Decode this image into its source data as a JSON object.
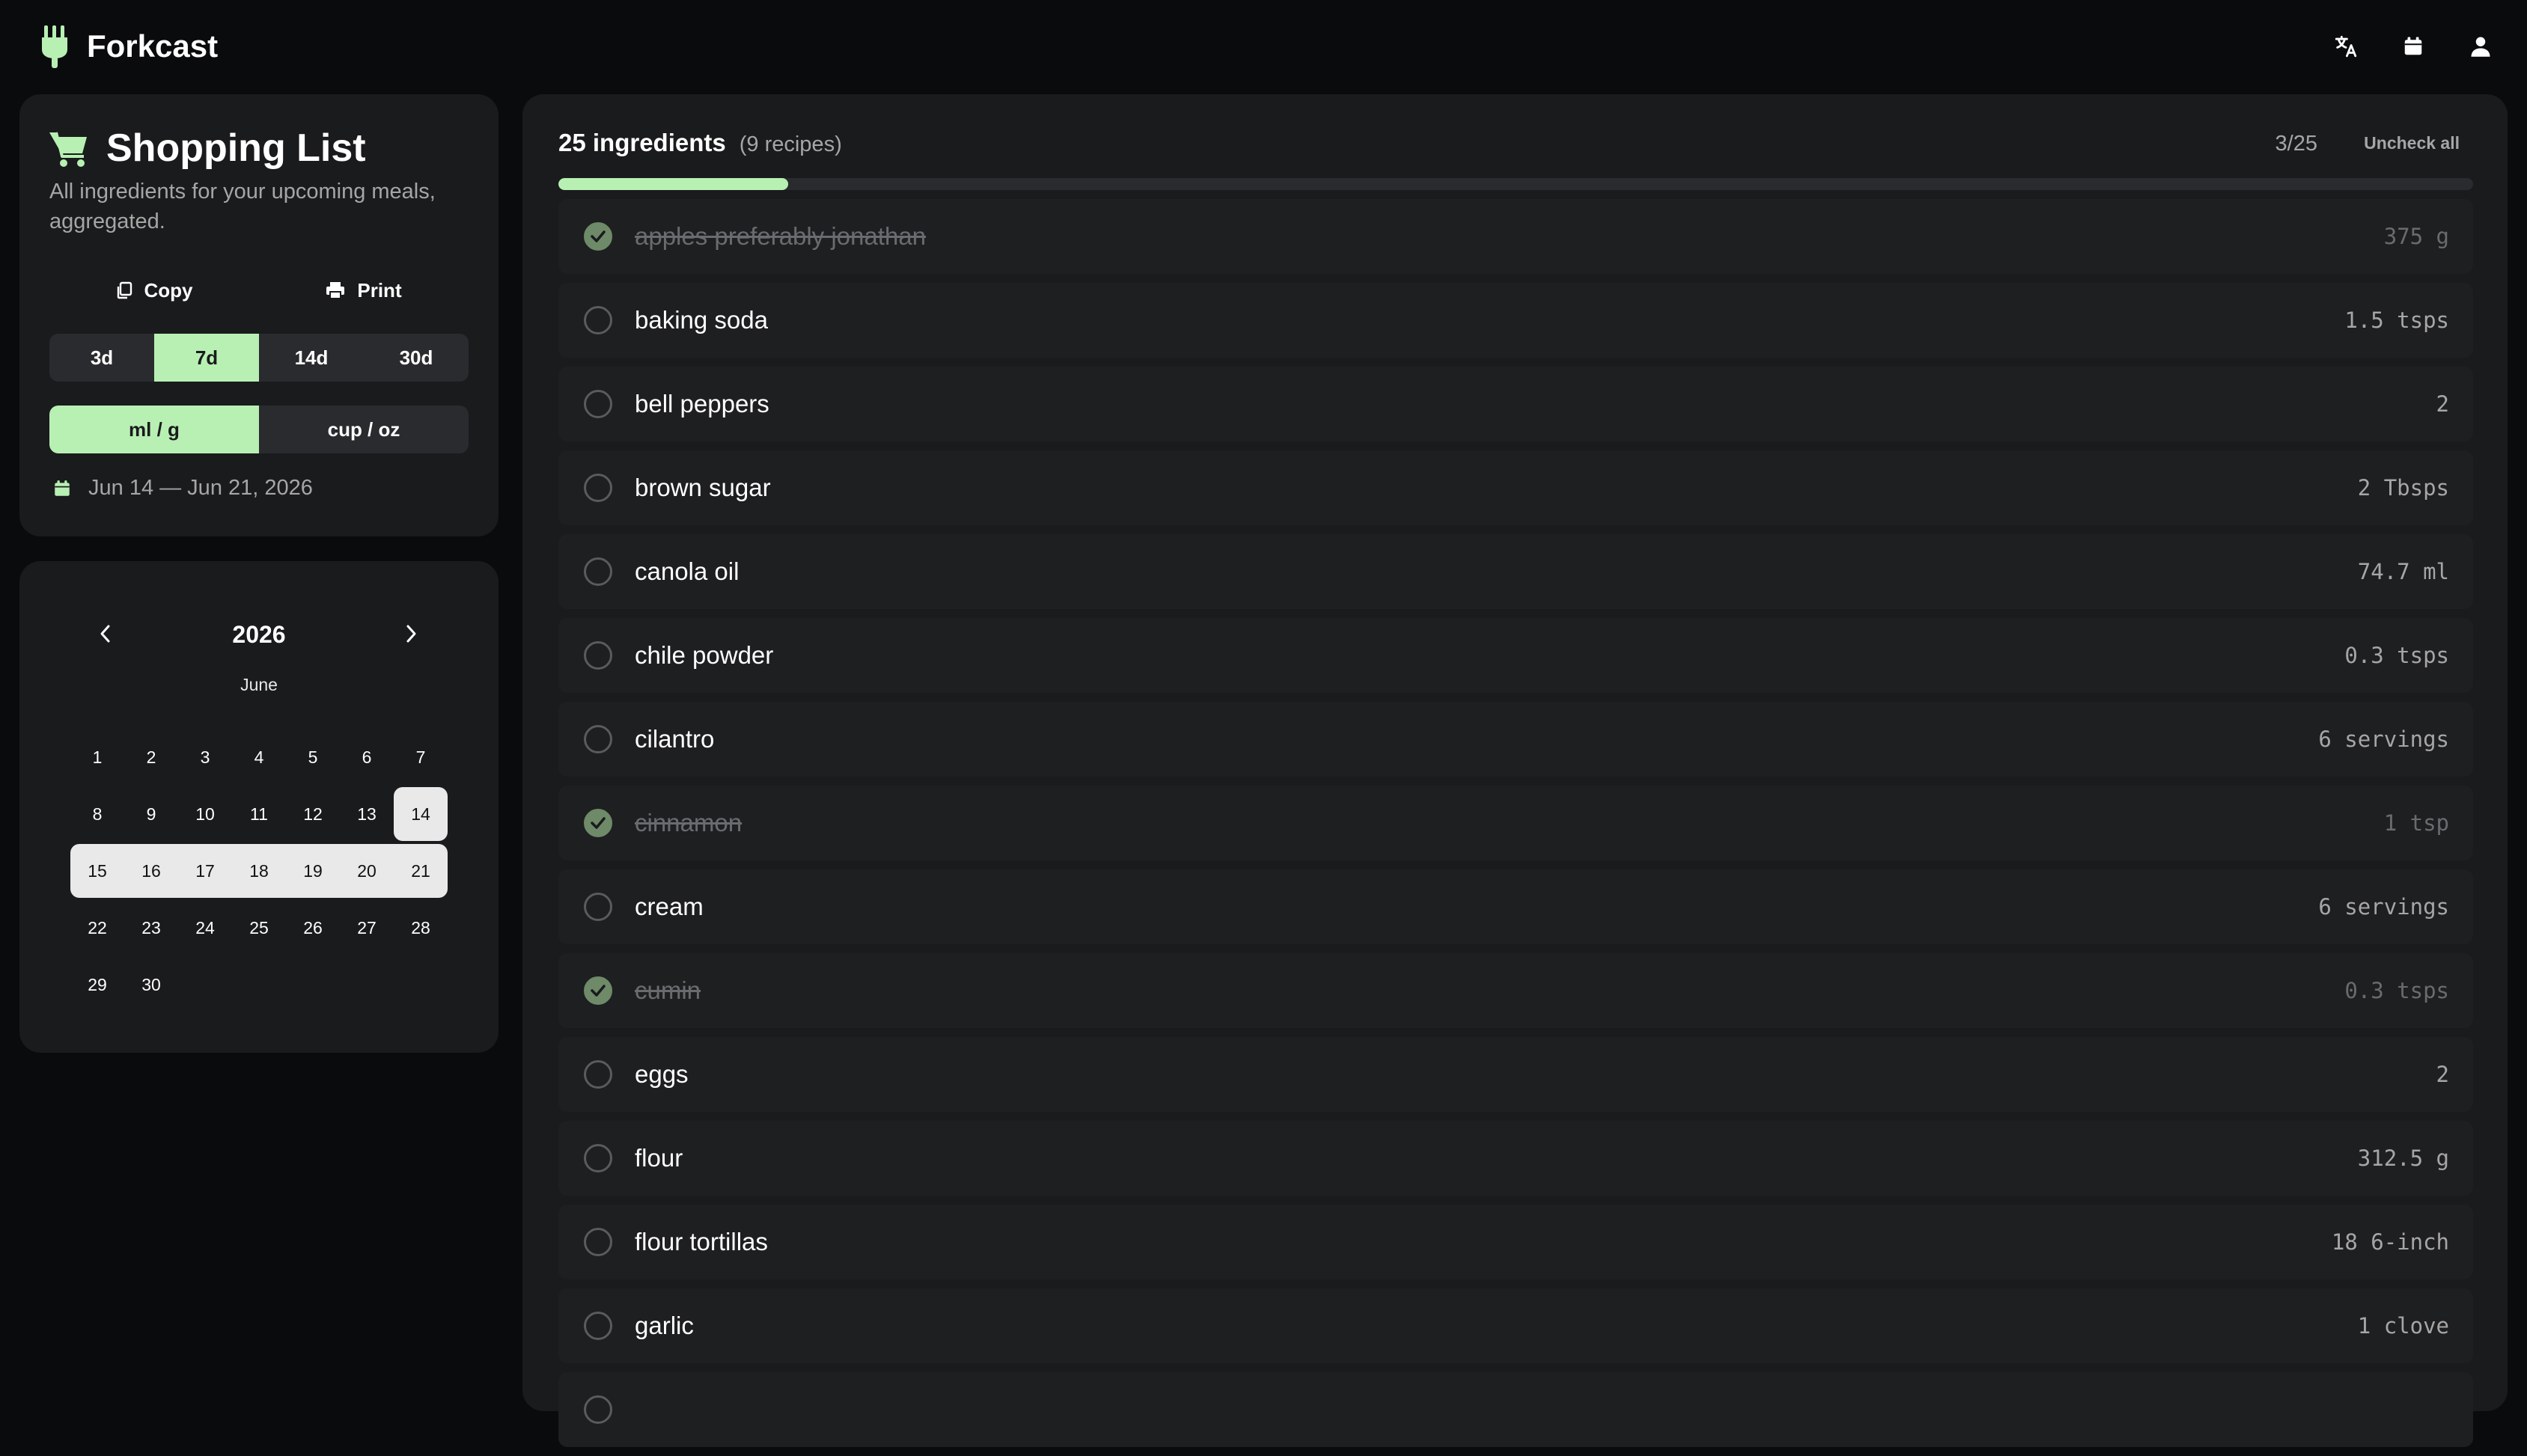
{
  "app": {
    "name": "Forkcast"
  },
  "header_icons": [
    "translate-icon",
    "calendar-icon",
    "user-icon"
  ],
  "shopping": {
    "title": "Shopping List",
    "description": "All ingredients for your upcoming meals, aggregated.",
    "copy_label": "Copy",
    "print_label": "Print",
    "day_ranges": [
      "3d",
      "7d",
      "14d",
      "30d"
    ],
    "selected_range": "7d",
    "unit_systems": [
      "ml / g",
      "cup / oz"
    ],
    "selected_unit": "ml / g",
    "date_range": "Jun 14 — Jun 21, 2026"
  },
  "calendar": {
    "year": "2026",
    "month": "June",
    "weeks": [
      [
        "1",
        "2",
        "3",
        "4",
        "5",
        "6",
        "7"
      ],
      [
        "8",
        "9",
        "10",
        "11",
        "12",
        "13",
        "14"
      ],
      [
        "15",
        "16",
        "17",
        "18",
        "19",
        "20",
        "21"
      ],
      [
        "22",
        "23",
        "24",
        "25",
        "26",
        "27",
        "28"
      ],
      [
        "29",
        "30"
      ]
    ],
    "start_day": "14",
    "selected_week_index": 2
  },
  "main": {
    "count_title": "25 ingredients",
    "recipes_sub": "(9 recipes)",
    "progress_text": "3/25",
    "progress_fraction": 0.12,
    "uncheck_label": "Uncheck all",
    "items": [
      {
        "name": "apples preferably jonathan",
        "qty": "375 g",
        "checked": true
      },
      {
        "name": "baking soda",
        "qty": "1.5 tsps",
        "checked": false
      },
      {
        "name": "bell peppers",
        "qty": "2",
        "checked": false
      },
      {
        "name": "brown sugar",
        "qty": "2 Tbsps",
        "checked": false
      },
      {
        "name": "canola oil",
        "qty": "74.7 ml",
        "checked": false
      },
      {
        "name": "chile powder",
        "qty": "0.3 tsps",
        "checked": false
      },
      {
        "name": "cilantro",
        "qty": "6 servings",
        "checked": false
      },
      {
        "name": "cinnamon",
        "qty": "1 tsp",
        "checked": true
      },
      {
        "name": "cream",
        "qty": "6 servings",
        "checked": false
      },
      {
        "name": "cumin",
        "qty": "0.3 tsps",
        "checked": true
      },
      {
        "name": "eggs",
        "qty": "2",
        "checked": false
      },
      {
        "name": "flour",
        "qty": "312.5 g",
        "checked": false
      },
      {
        "name": "flour tortillas",
        "qty": "18 6-inch",
        "checked": false
      },
      {
        "name": "garlic",
        "qty": "1 clove",
        "checked": false
      },
      {
        "name": "",
        "qty": "",
        "checked": false
      }
    ]
  },
  "colors": {
    "accent": "#b8f0b4",
    "background": "#0a0b0d",
    "card": "#1a1b1d",
    "checked": "#6e8a68"
  }
}
